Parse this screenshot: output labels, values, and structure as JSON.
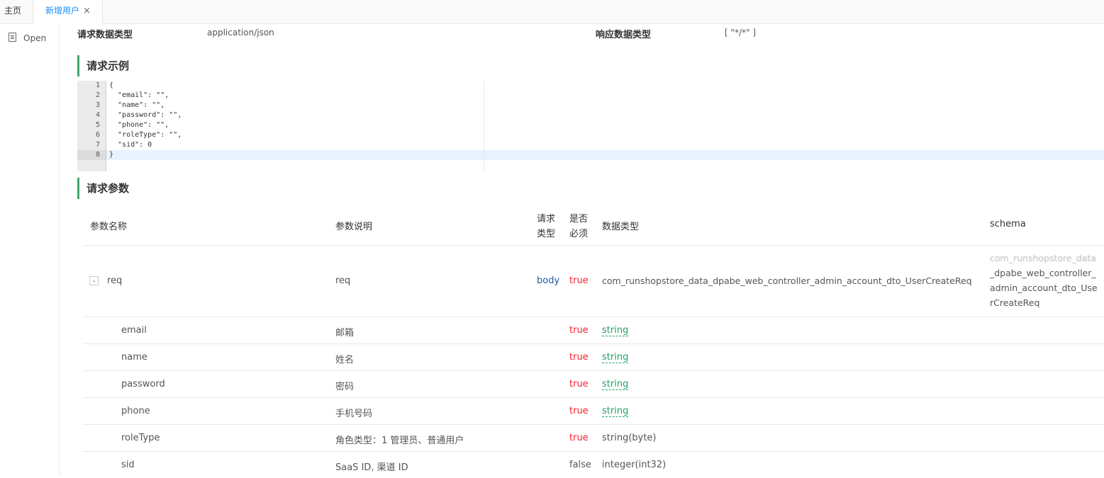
{
  "tabs": [
    {
      "label": "主页"
    },
    {
      "label": "新增用户",
      "close": "×"
    }
  ],
  "sidebar": {
    "open_label": "Open"
  },
  "meta": {
    "req_type_label": "请求数据类型",
    "req_type_value": "application/json",
    "resp_type_label": "响应数据类型",
    "resp_type_value": "[ \"*/*\" ]"
  },
  "sections": {
    "request_example": "请求示例",
    "request_params": "请求参数"
  },
  "code": {
    "line_numbers": [
      "1",
      "2",
      "3",
      "4",
      "5",
      "6",
      "7",
      "8"
    ],
    "lines": [
      "{",
      "  \"email\": \"\",",
      "  \"name\": \"\",",
      "  \"password\": \"\",",
      "  \"phone\": \"\",",
      "  \"roleType\": \"\",",
      "  \"sid\": 0",
      "}"
    ]
  },
  "params_table": {
    "headers": {
      "name": "参数名称",
      "desc": "参数说明",
      "in_1": "请求",
      "in_2": "类型",
      "req_1": "是否",
      "req_2": "必须",
      "type": "数据类型",
      "schema": "schema"
    },
    "root": {
      "toggle": "-",
      "name": "req",
      "desc": "req",
      "in": "body",
      "required": "true",
      "type": "com_runshopstore_data_dpabe_web_controller_admin_account_dto_UserCreateReq",
      "schema_1": "com_runshopstore_data",
      "schema_2": "_dpabe_web_controller_",
      "schema_3": "admin_account_dto_Use",
      "schema_4": "rCreateReq"
    },
    "rows": [
      {
        "name": "email",
        "desc": "邮箱",
        "required": "true",
        "type": "string"
      },
      {
        "name": "name",
        "desc": "姓名",
        "required": "true",
        "type": "string"
      },
      {
        "name": "password",
        "desc": "密码",
        "required": "true",
        "type": "string"
      },
      {
        "name": "phone",
        "desc": "手机号码",
        "required": "true",
        "type": "string"
      },
      {
        "name": "roleType",
        "desc": "角色类型：1 管理员、普通用户",
        "required": "true",
        "type": "string(byte)"
      },
      {
        "name": "sid",
        "desc": "SaaS ID, 渠道 ID",
        "required": "false",
        "type": "integer(int32)"
      }
    ]
  },
  "colors": {
    "accent_green": "#3ea870",
    "tab_active": "#1890ff",
    "required_red": "#f5222d",
    "body_blue": "#1d5ca7"
  }
}
